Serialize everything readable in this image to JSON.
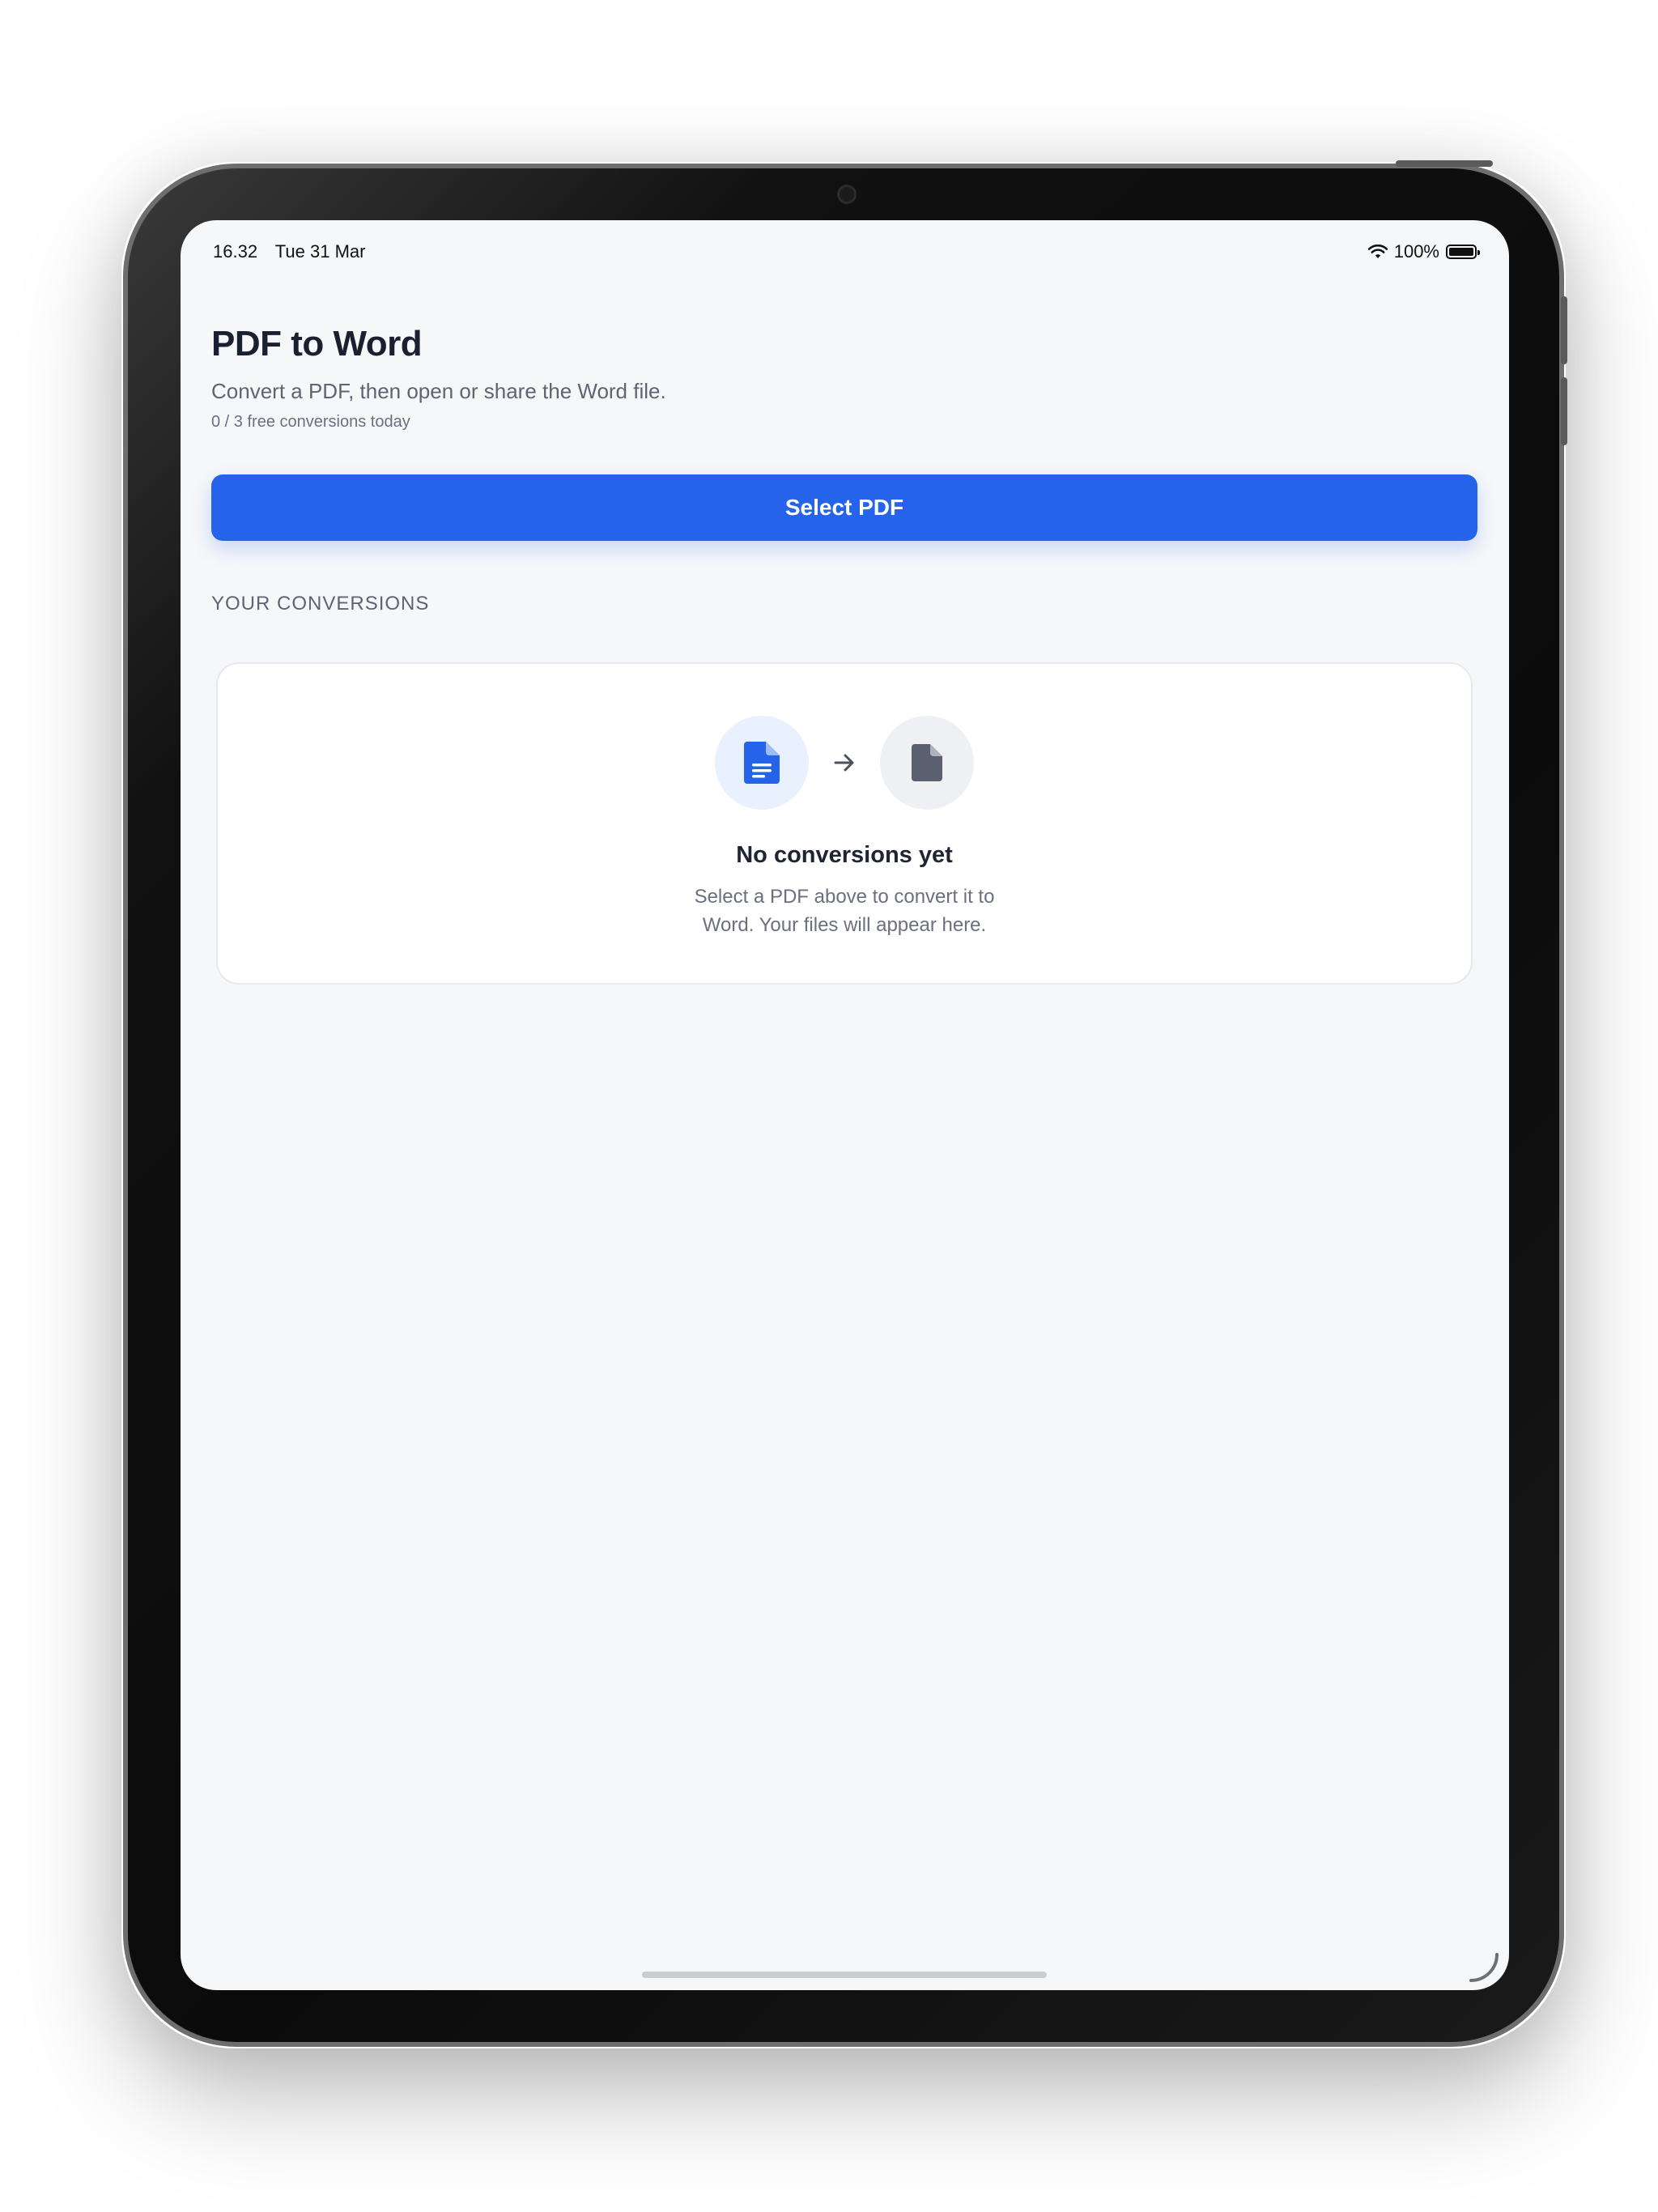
{
  "status_bar": {
    "time": "16.32",
    "date": "Tue 31 Mar",
    "wifi_icon": "wifi-icon",
    "battery_percent": "100%",
    "battery_level": 1.0
  },
  "header": {
    "title": "PDF to Word",
    "subtitle": "Convert a PDF, then open or share the Word file.",
    "quota": "0 / 3 free conversions today"
  },
  "actions": {
    "select_label": "Select PDF"
  },
  "conversions": {
    "section_title": "YOUR CONVERSIONS",
    "empty_state": {
      "icons": [
        "pdf-document-icon",
        "arrow-right-icon",
        "word-document-icon"
      ],
      "title": "No conversions yet",
      "description_line1": "Select a PDF above to convert it to",
      "description_line2": "Word. Your files will appear here."
    }
  },
  "colors": {
    "accent": "#2563eb",
    "background": "#f6f7f9",
    "card": "#ffffff",
    "text_primary": "#1b2030",
    "text_secondary": "#5f6472",
    "doc_icon_gray": "#5b6070"
  }
}
